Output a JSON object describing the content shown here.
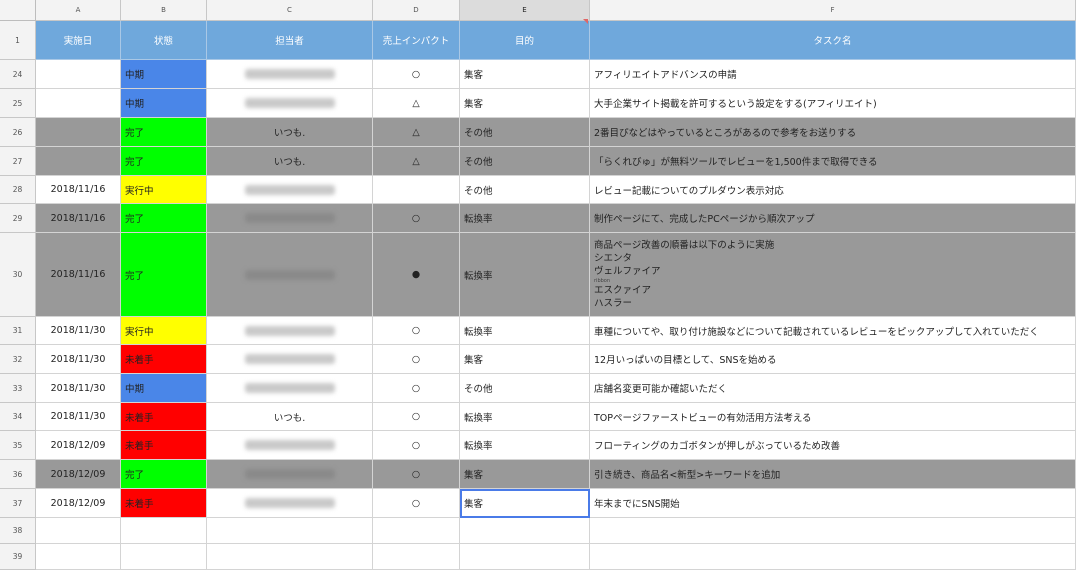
{
  "columns": [
    {
      "letter": "A",
      "header": "実施日"
    },
    {
      "letter": "B",
      "header": "状態"
    },
    {
      "letter": "C",
      "header": "担当者"
    },
    {
      "letter": "D",
      "header": "売上インパクト"
    },
    {
      "letter": "E",
      "header": "目的"
    },
    {
      "letter": "F",
      "header": "タスク名"
    }
  ],
  "header_row_number": "1",
  "rows": [
    {
      "num": "24",
      "date": "",
      "status": "中期",
      "status_color": "blue",
      "owner": "",
      "owner_blurred": true,
      "impact": "○",
      "purpose": "集客",
      "task": [
        "アフィリエイトアドバンスの申請"
      ],
      "gray": false
    },
    {
      "num": "25",
      "date": "",
      "status": "中期",
      "status_color": "blue",
      "owner": "",
      "owner_blurred": true,
      "impact": "△",
      "purpose": "集客",
      "task": [
        "大手企業サイト掲載を許可するという設定をする(アフィリエイト)"
      ],
      "gray": false
    },
    {
      "num": "26",
      "date": "",
      "status": "完了",
      "status_color": "green",
      "owner": "いつも.",
      "owner_blurred": false,
      "impact": "△",
      "purpose": "その他",
      "task": [
        "2番目ぴなどはやっているところがあるので参考をお送りする"
      ],
      "gray": true
    },
    {
      "num": "27",
      "date": "",
      "status": "完了",
      "status_color": "green",
      "owner": "いつも.",
      "owner_blurred": false,
      "impact": "△",
      "purpose": "その他",
      "task": [
        "「らくれびゅ」が無料ツールでレビューを1,500件まで取得できる"
      ],
      "gray": true
    },
    {
      "num": "28",
      "date": "2018/11/16",
      "status": "実行中",
      "status_color": "yellow",
      "owner": "",
      "owner_blurred": true,
      "impact": "",
      "purpose": "その他",
      "task": [
        "レビュー記載についてのプルダウン表示対応"
      ],
      "gray": false
    },
    {
      "num": "29",
      "date": "2018/11/16",
      "status": "完了",
      "status_color": "green",
      "owner": "",
      "owner_blurred": true,
      "impact": "○",
      "purpose": "転換率",
      "task": [
        "制作ページにて、完成したPCページから順次アップ"
      ],
      "gray": true
    },
    {
      "num": "30",
      "date": "2018/11/16",
      "status": "完了",
      "status_color": "green",
      "owner": "",
      "owner_blurred": true,
      "impact": "●",
      "purpose": "転換率",
      "task": [
        "商品ページ改善の順番は以下のように実施",
        "シエンタ",
        "ヴェルファイア",
        "ribbon",
        "エスクァイア",
        "ハスラー"
      ],
      "gray": true
    },
    {
      "num": "31",
      "date": "2018/11/30",
      "status": "実行中",
      "status_color": "yellow",
      "owner": "",
      "owner_blurred": true,
      "impact": "○",
      "purpose": "転換率",
      "task": [
        "車種についてや、取り付け施設などについて記載されているレビューをピックアップして入れていただく"
      ],
      "gray": false
    },
    {
      "num": "32",
      "date": "2018/11/30",
      "status": "未着手",
      "status_color": "red",
      "owner": "",
      "owner_blurred": true,
      "impact": "○",
      "purpose": "集客",
      "task": [
        "12月いっぱいの目標として、SNSを始める"
      ],
      "gray": false
    },
    {
      "num": "33",
      "date": "2018/11/30",
      "status": "中期",
      "status_color": "blue",
      "owner": "",
      "owner_blurred": true,
      "impact": "○",
      "purpose": "その他",
      "task": [
        "店舗名変更可能か確認いただく"
      ],
      "gray": false
    },
    {
      "num": "34",
      "date": "2018/11/30",
      "status": "未着手",
      "status_color": "red",
      "owner": "いつも.",
      "owner_blurred": false,
      "impact": "○",
      "purpose": "転換率",
      "task": [
        "TOPページファーストビューの有効活用方法考える"
      ],
      "gray": false
    },
    {
      "num": "35",
      "date": "2018/12/09",
      "status": "未着手",
      "status_color": "red",
      "owner": "",
      "owner_blurred": true,
      "impact": "○",
      "purpose": "転換率",
      "task": [
        "フローティングのカゴボタンが押しがぶっているため改善"
      ],
      "gray": false
    },
    {
      "num": "36",
      "date": "2018/12/09",
      "status": "完了",
      "status_color": "green",
      "owner": "",
      "owner_blurred": true,
      "impact": "○",
      "purpose": "集客",
      "task": [
        "引き続き、商品名<新型>キーワードを追加"
      ],
      "gray": true
    },
    {
      "num": "37",
      "date": "2018/12/09",
      "status": "未着手",
      "status_color": "red",
      "owner": "",
      "owner_blurred": true,
      "impact": "○",
      "purpose": "集客",
      "task": [
        "年末までにSNS開始"
      ],
      "gray": false,
      "active_col": "E"
    }
  ],
  "empty_rows": [
    "38",
    "39"
  ],
  "selected_column": "E",
  "colors": {
    "header_blue": "#6fa8dc",
    "status_blue": "#4a86e8",
    "status_green": "#00ff00",
    "status_yellow": "#ffff00",
    "status_red": "#ff0000",
    "row_gray": "#999999"
  }
}
